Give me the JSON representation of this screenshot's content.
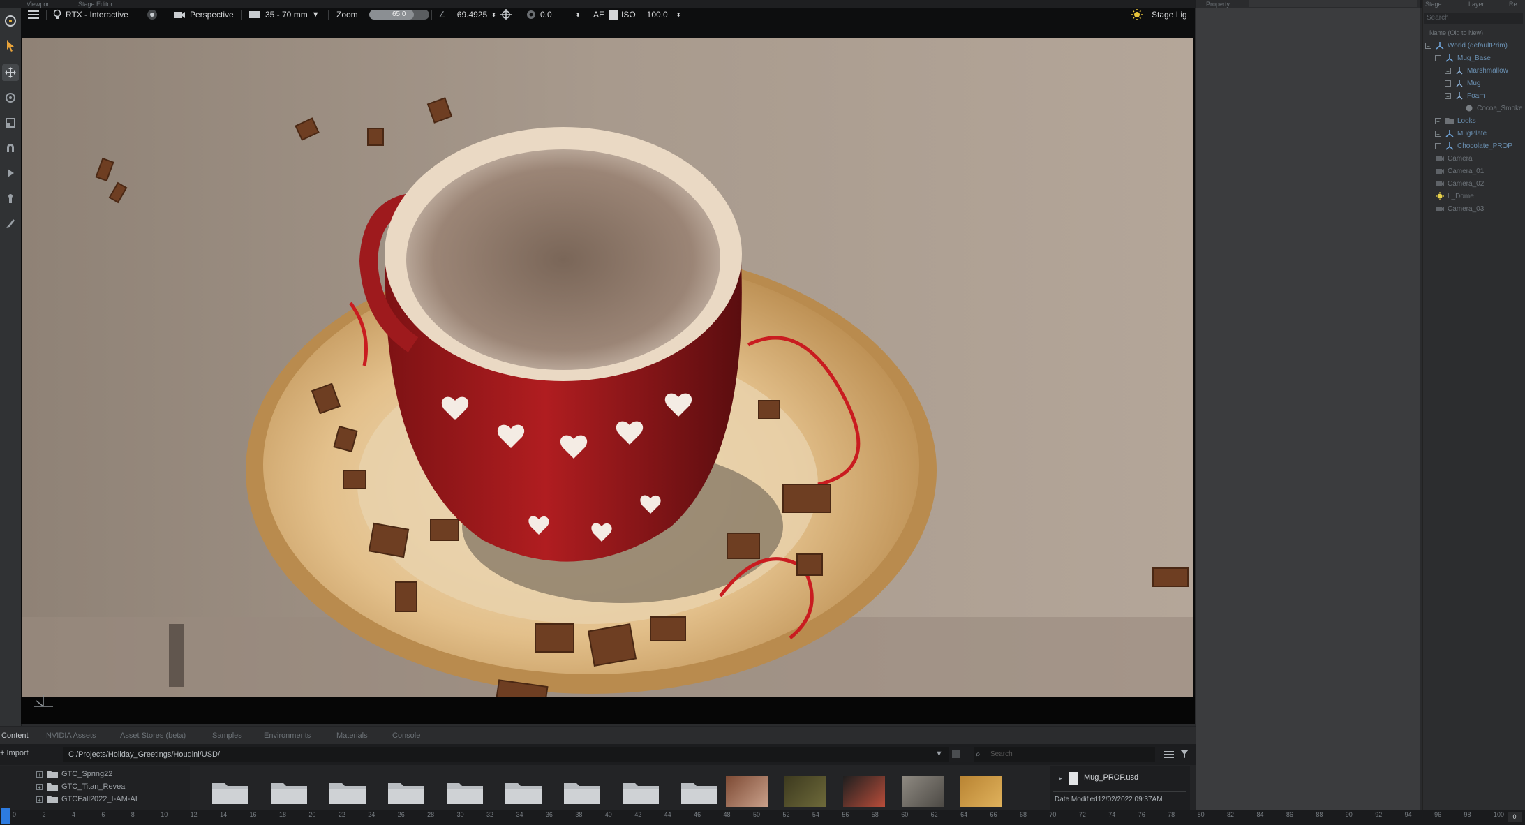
{
  "window": {
    "top_tabs": [
      "Viewport",
      "Stage Editor"
    ],
    "property_header": "Property",
    "stage_tabs": [
      "Stage",
      "Layer",
      "Re"
    ]
  },
  "left_tools": [
    "toolbar-menu-icon",
    "select-arrow-icon",
    "move-icon",
    "rotate-icon",
    "scale-icon",
    "magnet-icon",
    "play-icon",
    "paint-icon",
    "brush-icon"
  ],
  "viewport_toolbar": {
    "render_mode": "RTX - Interactive",
    "camera": "Perspective",
    "lens": "35 - 70 mm",
    "zoom_label": "Zoom",
    "zoom_value": "65.0",
    "zoom_fraction": 0.75,
    "fov_value": "69.4925",
    "exposure_value": "0.0",
    "ae_label": "AE",
    "iso_label": "ISO",
    "iso_value": "100.0",
    "stage_lights_label": "Stage Lig"
  },
  "stage": {
    "search_placeholder": "Search",
    "column_header": "Name (Old to New)",
    "tree": [
      {
        "label": "World (defaultPrim)",
        "depth": 0,
        "expander": "-",
        "icon": "xform-icon"
      },
      {
        "label": "Mug_Base",
        "depth": 1,
        "expander": "-",
        "icon": "xform-icon"
      },
      {
        "label": "Marshmallow",
        "depth": 2,
        "expander": "+",
        "icon": "mesh-icon"
      },
      {
        "label": "Mug",
        "depth": 2,
        "expander": "+",
        "icon": "mesh-icon"
      },
      {
        "label": "Foam",
        "depth": 2,
        "expander": "+",
        "icon": "mesh-icon"
      },
      {
        "label": "Cocoa_Smoke",
        "depth": 3,
        "expander": "",
        "icon": "volume-icon"
      },
      {
        "label": "Looks",
        "depth": 1,
        "expander": "+",
        "icon": "folder-icon"
      },
      {
        "label": "MugPlate",
        "depth": 1,
        "expander": "+",
        "icon": "xform-icon"
      },
      {
        "label": "Chocolate_PROP",
        "depth": 1,
        "expander": "+",
        "icon": "xform-icon"
      },
      {
        "label": "Camera",
        "depth": 0,
        "expander": "",
        "icon": "camera-icon"
      },
      {
        "label": "Camera_01",
        "depth": 0,
        "expander": "",
        "icon": "camera-icon"
      },
      {
        "label": "Camera_02",
        "depth": 0,
        "expander": "",
        "icon": "camera-icon"
      },
      {
        "label": "L_Dome",
        "depth": 0,
        "expander": "",
        "icon": "light-icon"
      },
      {
        "label": "Camera_03",
        "depth": 0,
        "expander": "",
        "icon": "camera-icon"
      }
    ]
  },
  "content": {
    "tabs": [
      "Content",
      "NVIDIA Assets",
      "Asset Stores (beta)",
      "Samples",
      "Environments",
      "Materials",
      "Console"
    ],
    "import_label": "Import",
    "path": "C:/Projects/Holiday_Greetings/Houdini/USD/",
    "search_placeholder": "Search",
    "folders": [
      "GTC_Spring22",
      "GTC_Titan_Reveal",
      "GTCFall2022_I-AM-AI"
    ],
    "selected_file": "Mug_PROP.usd",
    "date_modified": "Date Modified12/02/2022 09:37AM"
  },
  "timeline": {
    "ticks": [
      "0",
      "2",
      "4",
      "6",
      "8",
      "10",
      "12",
      "14",
      "16",
      "18",
      "20",
      "22",
      "24",
      "26",
      "28",
      "30",
      "32",
      "34",
      "36",
      "38",
      "40",
      "42",
      "44",
      "46",
      "48",
      "50",
      "52",
      "54",
      "56",
      "58",
      "60",
      "62",
      "64",
      "66",
      "68",
      "70",
      "72",
      "74",
      "76",
      "78",
      "80",
      "82",
      "84",
      "86",
      "88",
      "90",
      "92",
      "94",
      "96",
      "98",
      "100"
    ],
    "end_value": "0"
  },
  "colors": {
    "accent": "#2d7be0",
    "mug_red": "#a4191c",
    "plate_gold": "#d9a864",
    "wall": "#a8978a"
  }
}
